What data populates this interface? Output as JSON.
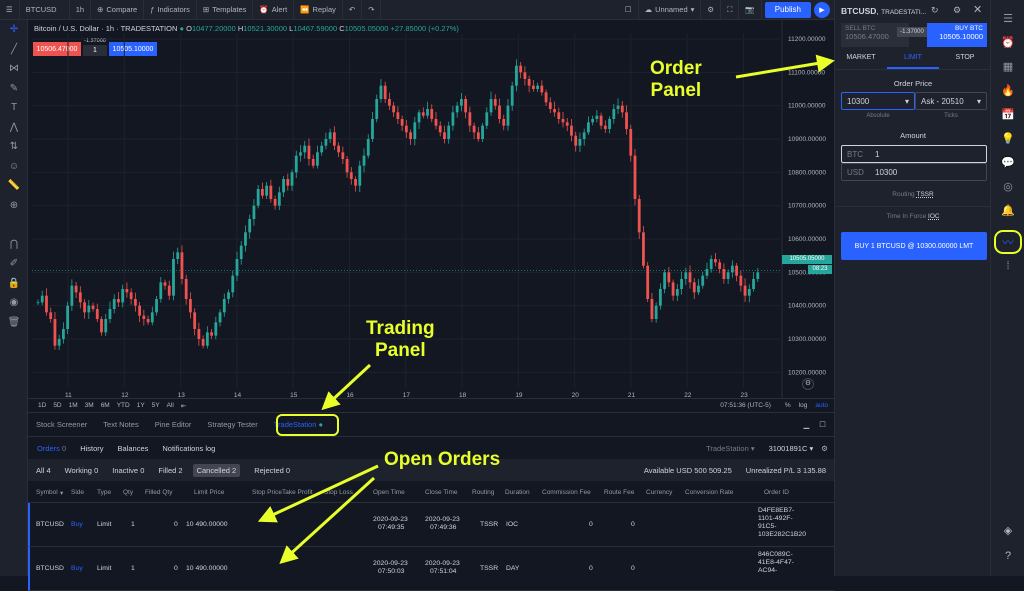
{
  "toolbar": {
    "menu_icon": "hamburger-icon",
    "symbol": "BTCUSD",
    "interval": "1h",
    "compare": "Compare",
    "indicators": "Indicators",
    "templates": "Templates",
    "alert": "Alert",
    "replay": "Replay",
    "layout_name": "Unnamed",
    "publish": "Publish"
  },
  "left_tools": [
    "crosshair-icon",
    "trendline-icon",
    "fib-icon",
    "brush-icon",
    "text-icon",
    "pattern-icon",
    "projection-icon",
    "emoji-icon",
    "ruler-icon",
    "zoom-icon",
    "magnet-icon",
    "lock-draw-icon",
    "lock-icon",
    "eye-icon",
    "trash-icon"
  ],
  "chart": {
    "legend_title": "Bitcoin / U.S. Dollar",
    "legend_interval": "1h",
    "legend_exchange": "TRADESTATION",
    "ohlc": {
      "o": "O",
      "o_val": "10477.20000",
      "h": "H",
      "h_val": "10521.30000",
      "l": "L",
      "l_val": "10467.59000",
      "c": "C",
      "c_val": "10505.05000",
      "chg": "+27.85000 (+0.27%)"
    },
    "sell_price": "10506.47000",
    "spread": "-1.37000",
    "qty": "1",
    "buy_price": "10505.10000",
    "last_price": "10505.05000",
    "countdown": "08:23",
    "ranges": [
      "1D",
      "5D",
      "1M",
      "3M",
      "6M",
      "YTD",
      "1Y",
      "5Y",
      "All"
    ],
    "time": "07:51:36 (UTC-5)",
    "pct": "%",
    "log": "log",
    "auto": "auto"
  },
  "chart_data": {
    "type": "candlestick",
    "yticks": [
      "11200.00000",
      "11100.00000",
      "11000.00000",
      "10900.00000",
      "10800.00000",
      "10700.00000",
      "10600.00000",
      "10500.00000",
      "10400.00000",
      "10300.00000",
      "10200.00000"
    ],
    "ytick_values": [
      11200,
      11100,
      11000,
      10900,
      10800,
      10700,
      10600,
      10500,
      10400,
      10300,
      10200
    ],
    "xticks": [
      "11",
      "12",
      "13",
      "14",
      "15",
      "16",
      "17",
      "18",
      "19",
      "20",
      "21",
      "22",
      "23"
    ],
    "ylim": [
      10153,
      11215
    ],
    "series": [
      10410,
      10430,
      10380,
      10360,
      10280,
      10300,
      10330,
      10400,
      10460,
      10440,
      10410,
      10380,
      10400,
      10390,
      10360,
      10320,
      10360,
      10390,
      10420,
      10410,
      10450,
      10440,
      10420,
      10400,
      10370,
      10360,
      10350,
      10380,
      10420,
      10470,
      10460,
      10430,
      10540,
      10560,
      10480,
      10420,
      10380,
      10330,
      10300,
      10280,
      10320,
      10310,
      10350,
      10380,
      10420,
      10440,
      10490,
      10540,
      10580,
      10620,
      10660,
      10700,
      10750,
      10730,
      10760,
      10720,
      10700,
      10740,
      10780,
      10760,
      10800,
      10850,
      10860,
      10880,
      10840,
      10820,
      10860,
      10880,
      10900,
      10920,
      10880,
      10860,
      10840,
      10800,
      10780,
      10760,
      10820,
      10850,
      10900,
      10960,
      11020,
      11060,
      11020,
      11000,
      10980,
      10960,
      10940,
      10920,
      10900,
      10950,
      10980,
      10970,
      10990,
      10960,
      10940,
      10920,
      10900,
      10940,
      10980,
      11000,
      11020,
      10980,
      10940,
      10920,
      10900,
      10940,
      10980,
      11020,
      11000,
      10960,
      10940,
      11000,
      11060,
      11120,
      11100,
      11080,
      11060,
      11050,
      11060,
      11040,
      11010,
      10990,
      10980,
      10960,
      10950,
      10940,
      10910,
      10880,
      10900,
      10920,
      10950,
      10960,
      10970,
      10940,
      10930,
      10960,
      10990,
      11000,
      10980,
      10930,
      10850,
      10720,
      10620,
      10520,
      10420,
      10360,
      10400,
      10450,
      10500,
      10470,
      10430,
      10450,
      10480,
      10500,
      10470,
      10440,
      10460,
      10490,
      10510,
      10540,
      10530,
      10510,
      10480,
      10500,
      10520,
      10490,
      10460,
      10430,
      10450,
      10480,
      10500
    ]
  },
  "bottom": {
    "tabs": [
      "Stock Screener",
      "Text Notes",
      "Pine Editor",
      "Strategy Tester",
      "TradeStation"
    ],
    "subtabs": {
      "orders": "Orders",
      "orders_count": "0",
      "history": "History",
      "balances": "Balances",
      "notifications": "Notifications log"
    },
    "broker": "TradeStation",
    "account": "31001891C",
    "filters": [
      {
        "label": "All",
        "count": "4"
      },
      {
        "label": "Working",
        "count": "0"
      },
      {
        "label": "Inactive",
        "count": "0"
      },
      {
        "label": "Filled",
        "count": "2"
      },
      {
        "label": "Cancelled",
        "count": "2"
      },
      {
        "label": "Rejected",
        "count": "0"
      }
    ],
    "available_label": "Available USD",
    "available_val": "500 509.25",
    "unreal_label": "Unrealized P/L",
    "unreal_val": "3 135.88",
    "columns": [
      "Symbol",
      "Side",
      "Type",
      "Qty",
      "Filled Qty",
      "Limit Price",
      "Stop Price",
      "Take Profit",
      "Stop Loss",
      "Open Time",
      "Close Time",
      "Routing",
      "Duration",
      "Commission Fee",
      "Route Fee",
      "Currency",
      "Conversion Rate",
      "Order ID"
    ],
    "rows": [
      {
        "symbol": "BTCUSD",
        "side": "Buy",
        "type": "Limit",
        "qty": "1",
        "filled": "0",
        "limit": "10 490.00000",
        "open_date": "2020-09-23",
        "open_time": "07:49:35",
        "close_date": "2020-09-23",
        "close_time": "07:49:36",
        "routing": "TSSR",
        "duration": "IOC",
        "comm": "0",
        "route": "0",
        "id1": "D4FE8EB7-",
        "id2": "1101-492F-",
        "id3": "91C5-",
        "id4": "103E282C1B20"
      },
      {
        "symbol": "BTCUSD",
        "side": "Buy",
        "type": "Limit",
        "qty": "1",
        "filled": "0",
        "limit": "10 490.00000",
        "open_date": "2020-09-23",
        "open_time": "07:50:03",
        "close_date": "2020-09-23",
        "close_time": "07:51:04",
        "routing": "TSSR",
        "duration": "DAY",
        "comm": "0",
        "route": "0",
        "id1": "846C089C-",
        "id2": "41E8-4F47-",
        "id3": "AC94-",
        "id4": ""
      }
    ]
  },
  "order_panel": {
    "symbol": "BTCUSD",
    "exchange": "TRADESTATI...",
    "sell_label": "SELL BTC",
    "sell_price": "10506.47000",
    "spread": "-1.37000",
    "buy_label": "BUY BTC",
    "buy_price": "10505.10000",
    "tabs": [
      "MARKET",
      "LIMIT",
      "STOP"
    ],
    "order_price_label": "Order Price",
    "price_value": "10300",
    "price_mode": "Ask - 20510",
    "absolute": "Absolute",
    "ticks": "Ticks",
    "amount_label": "Amount",
    "btc_label": "BTC",
    "btc_value": "1",
    "usd_label": "USD",
    "usd_value": "10300",
    "routing_label": "Routing",
    "routing_value": "TSSR",
    "tif_label": "Time In Force",
    "tif_value": "IOC",
    "submit": "BUY 1 BTCUSD @ 10300.00000 LMT"
  },
  "right_icons": [
    "watchlist-icon",
    "alerts-icon",
    "data-window-icon",
    "hotlist-icon",
    "calendar-icon",
    "ideas-icon",
    "chat-icon",
    "streams-icon",
    "notifications-icon",
    "trading-panel-icon",
    "dom-icon",
    "layers-icon",
    "help-icon"
  ],
  "annotations": {
    "order_panel": "Order\nPanel",
    "trading_panel": "Trading\nPanel",
    "open_orders": "Open Orders"
  },
  "colors": {
    "up": "#26a69a",
    "down": "#ef5350",
    "accent": "#2962ff",
    "annotation": "#e8ff2a"
  }
}
